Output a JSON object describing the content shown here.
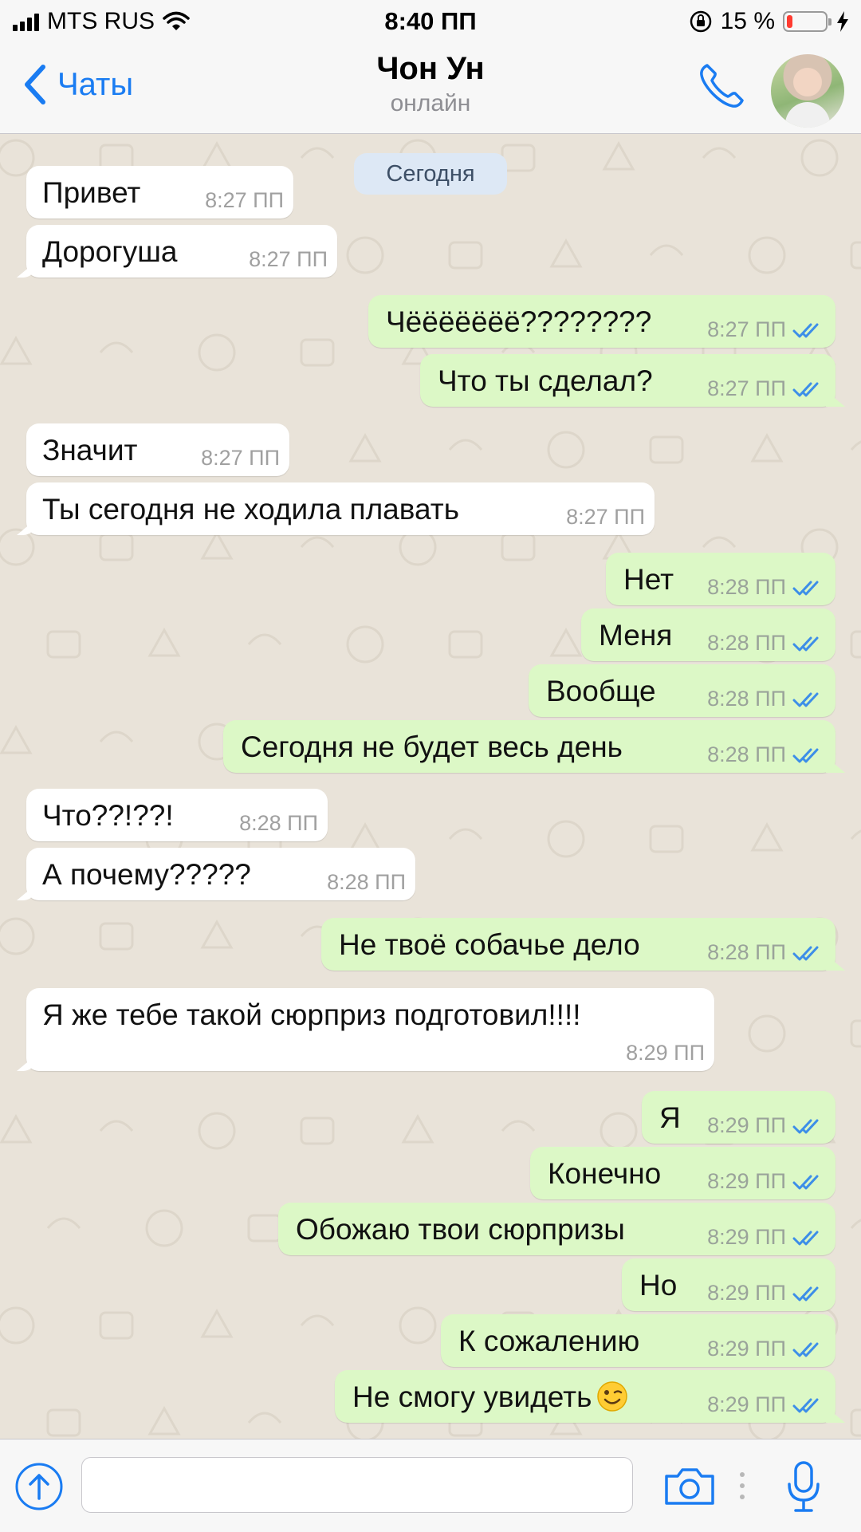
{
  "status_bar": {
    "carrier": "MTS RUS",
    "time": "8:40 ПП",
    "battery_percent": "15 %",
    "battery_level": 0.15
  },
  "header": {
    "back_label": "Чаты",
    "contact_name": "Чон Ун",
    "contact_status": "онлайн"
  },
  "day_separator": "Сегодня",
  "messages": [
    {
      "dir": "in",
      "text": "Привет",
      "time": "8:27 ПП"
    },
    {
      "dir": "in",
      "text": "Дорогуша",
      "time": "8:27 ПП"
    },
    {
      "dir": "out",
      "text": "Чёёёёёёё????????",
      "time": "8:27 ПП",
      "read": true
    },
    {
      "dir": "out",
      "text": "Что ты сделал?",
      "time": "8:27 ПП",
      "read": true
    },
    {
      "dir": "in",
      "text": "Значит",
      "time": "8:27 ПП"
    },
    {
      "dir": "in",
      "text": "Ты сегодня не ходила плавать",
      "time": "8:27 ПП"
    },
    {
      "dir": "out",
      "text": "Нет",
      "time": "8:28 ПП",
      "read": true
    },
    {
      "dir": "out",
      "text": "Меня",
      "time": "8:28 ПП",
      "read": true
    },
    {
      "dir": "out",
      "text": "Вообще",
      "time": "8:28 ПП",
      "read": true
    },
    {
      "dir": "out",
      "text": "Сегодня не будет весь день",
      "time": "8:28 ПП",
      "read": true
    },
    {
      "dir": "in",
      "text": "Что??!??!",
      "time": "8:28 ПП"
    },
    {
      "dir": "in",
      "text": "А почему?????",
      "time": "8:28 ПП"
    },
    {
      "dir": "out",
      "text": "Не твоё собачье дело",
      "time": "8:28 ПП",
      "read": true
    },
    {
      "dir": "in",
      "text": "Я же тебе такой сюрприз подготовил!!!!",
      "time": "8:29 ПП"
    },
    {
      "dir": "out",
      "text": "Я",
      "time": "8:29 ПП",
      "read": true
    },
    {
      "dir": "out",
      "text": "Конечно",
      "time": "8:29 ПП",
      "read": true
    },
    {
      "dir": "out",
      "text": "Обожаю твои сюрпризы",
      "time": "8:29 ПП",
      "read": true
    },
    {
      "dir": "out",
      "text": "Но",
      "time": "8:29 ПП",
      "read": true
    },
    {
      "dir": "out",
      "text": "К сожалению",
      "time": "8:29 ПП",
      "read": true
    },
    {
      "dir": "out",
      "text": "Не смогу увидеть",
      "time": "8:29 ПП",
      "read": true,
      "emoji": "winking-face"
    }
  ],
  "input": {
    "value": "",
    "placeholder": ""
  },
  "colors": {
    "accent": "#1a7cf2",
    "outgoing_bubble": "#dcf8c6",
    "incoming_bubble": "#ffffff",
    "chat_background": "#e9e3d9",
    "read_ticks": "#3d8ee8",
    "battery_low": "#ff3b30"
  },
  "icons": [
    "signal-icon",
    "wifi-icon",
    "orientation-lock-icon",
    "battery-icon",
    "charging-bolt-icon",
    "back-chevron-icon",
    "phone-icon",
    "avatar",
    "double-check-icon",
    "winking-face-emoji",
    "attach-icon",
    "camera-icon",
    "more-dots-icon",
    "microphone-icon"
  ]
}
